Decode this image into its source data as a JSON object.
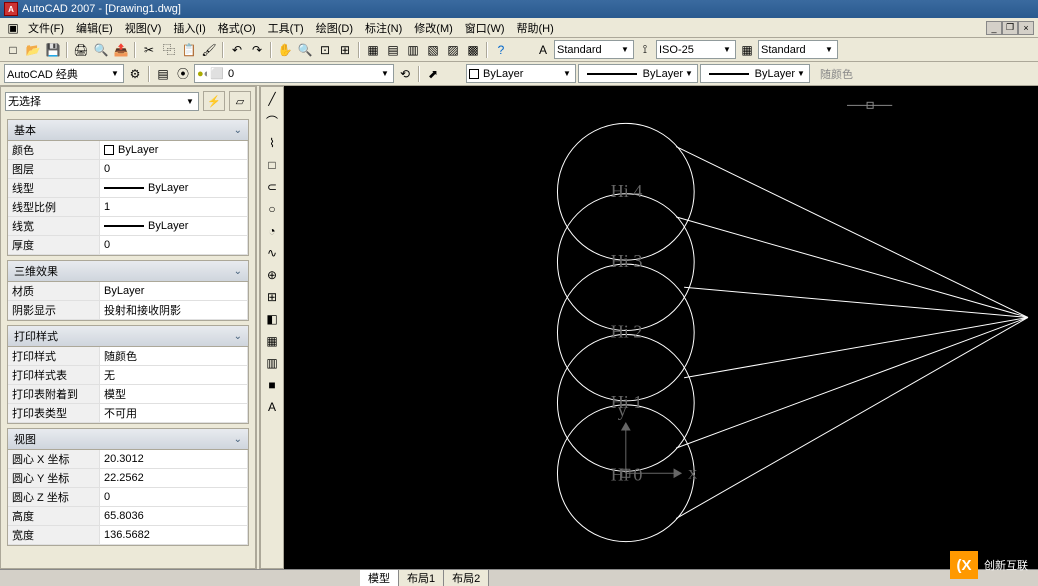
{
  "title": "AutoCAD 2007 - [Drawing1.dwg]",
  "title_icon": "A",
  "menu": [
    "文件(F)",
    "编辑(E)",
    "视图(V)",
    "插入(I)",
    "格式(O)",
    "工具(T)",
    "绘图(D)",
    "标注(N)",
    "修改(M)",
    "窗口(W)",
    "帮助(H)"
  ],
  "toolbar1": {
    "style1": "Standard",
    "dim": "ISO-25",
    "style2": "Standard"
  },
  "toolbar2": {
    "workspace": "AutoCAD 经典",
    "layer": "0",
    "color": "ByLayer",
    "linetype": "ByLayer",
    "lineweight": "ByLayer",
    "plotstyle": "随颜色"
  },
  "palette": {
    "selection": "无选择",
    "groups": [
      {
        "title": "基本",
        "rows": [
          {
            "label": "颜色",
            "value": "ByLayer",
            "swatch": true
          },
          {
            "label": "图层",
            "value": "0"
          },
          {
            "label": "线型",
            "value": "ByLayer",
            "line": true
          },
          {
            "label": "线型比例",
            "value": "1"
          },
          {
            "label": "线宽",
            "value": "ByLayer",
            "line": true
          },
          {
            "label": "厚度",
            "value": "0"
          }
        ]
      },
      {
        "title": "三维效果",
        "rows": [
          {
            "label": "材质",
            "value": "ByLayer"
          },
          {
            "label": "阴影显示",
            "value": "投射和接收阴影"
          }
        ]
      },
      {
        "title": "打印样式",
        "rows": [
          {
            "label": "打印样式",
            "value": "随颜色"
          },
          {
            "label": "打印样式表",
            "value": "无"
          },
          {
            "label": "打印表附着到",
            "value": "模型"
          },
          {
            "label": "打印表类型",
            "value": "不可用"
          }
        ]
      },
      {
        "title": "视图",
        "rows": [
          {
            "label": "圆心 X 坐标",
            "value": "20.3012"
          },
          {
            "label": "圆心 Y 坐标",
            "value": "22.2562"
          },
          {
            "label": "圆心 Z 坐标",
            "value": "0"
          },
          {
            "label": "高度",
            "value": "65.8036"
          },
          {
            "label": "宽度",
            "value": "136.5682"
          }
        ]
      }
    ]
  },
  "tool_icons": [
    "╱",
    "⌒",
    "⌇",
    "□",
    "⊂",
    "○",
    "◔",
    "∿",
    "⊕",
    "⊞",
    "◧",
    "▦",
    "▥",
    "■",
    "A"
  ],
  "tabs": [
    "模型",
    "布局1",
    "布局2"
  ],
  "active_tab": 0,
  "drawing_labels": [
    "Hi 4",
    "Hi 3",
    "Hi 2",
    "Hi 1",
    "Hi 0"
  ],
  "ucs": {
    "x": "x",
    "y": "y"
  },
  "brand": "创新互联"
}
